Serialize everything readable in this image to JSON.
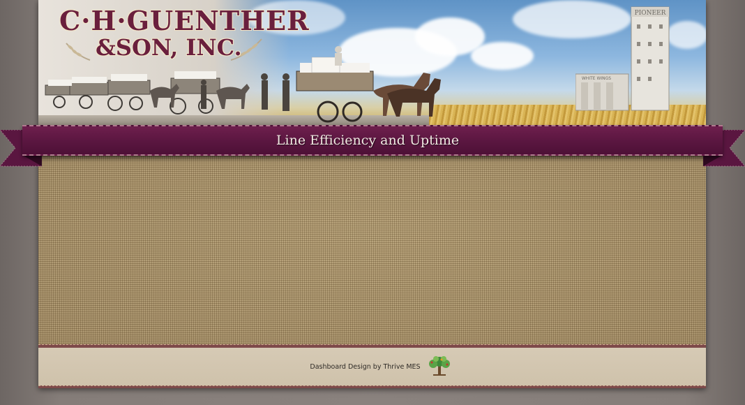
{
  "header": {
    "logo_line1": "C·H·GUENTHER",
    "logo_line2": "&SON, INC.",
    "elevator_sign": "PIONEER",
    "silo_sign": "WHITE WINGS"
  },
  "banner": {
    "title": "Line Efficiency and Uptime"
  },
  "footer": {
    "credit": "Dashboard Design by Thrive MES"
  },
  "icons": {
    "footer_logo": "tree-icon",
    "wheat": "wheat-icon"
  },
  "colors": {
    "ribbon": "#5a1640",
    "logo_text": "#6a1f3d",
    "burlap": "#a48d66",
    "footer_bg": "#d6cab5",
    "stitch": "#7e4a4a"
  }
}
